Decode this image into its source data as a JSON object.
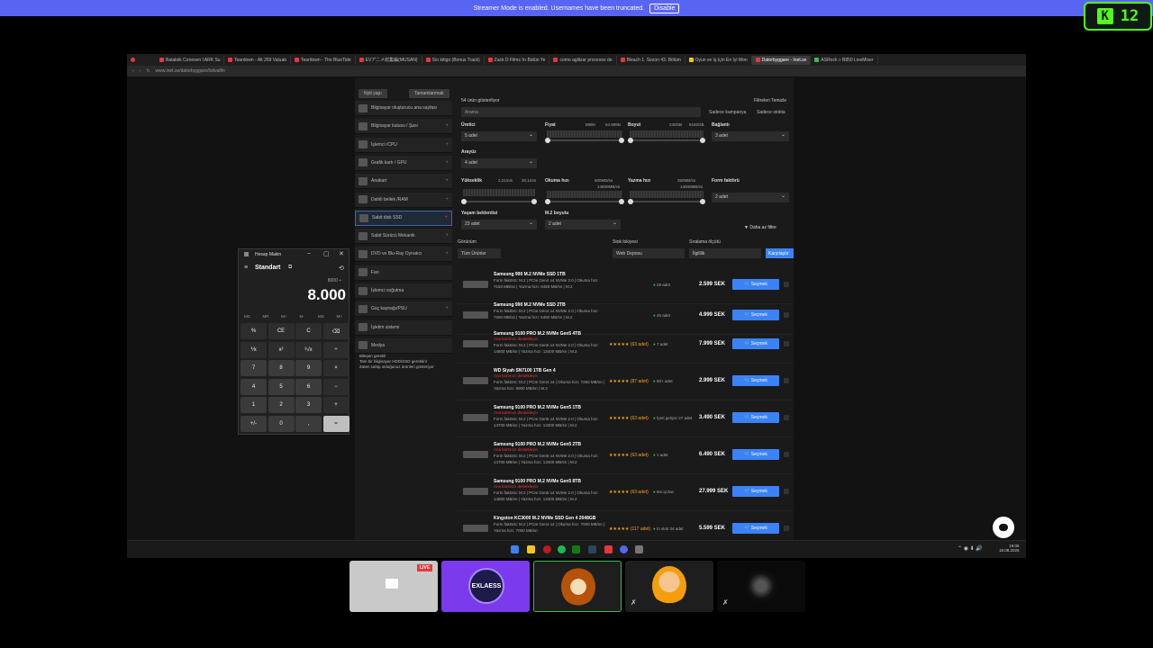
{
  "streamer": {
    "text": "Streamer Mode is enabled. Usernames have been truncated.",
    "disable": "Disable"
  },
  "kick": {
    "logo": "K",
    "count": "12"
  },
  "tabs": [
    "Batakkk Conexen l ARK Su",
    "Teardown - Alt 269 Valuab",
    "Teardown - The BlueTide",
    "EVアニメ総集編(MUSAN)",
    "S/o kitigo (Bonus Track)",
    "Zack D Films 'in Bütün Ye",
    "como agilizar procesos de",
    "Bleach 1. Sezon 43. Bölüm",
    "Oyun ve Iş Için En Iyi Mon",
    "Datorbyggare - Inet.se",
    "ASRock » B850 LiveMixer"
  ],
  "url": "www.inet.se/datorbyggare/lodvalfin",
  "site": {
    "btn_new": "Nytt yapı",
    "btn_complete": "Tamamlanmak",
    "categories": [
      "Bilgisayar oluşturucu ana sayfası",
      "Bilgisayar kutusu / Şasi",
      "İşlemci /CPU",
      "Grafik kartı / GPU",
      "Anakart",
      "Dahili bellek /RAM",
      "Sabit disk SSD",
      "Sabit Sürücü Mekanik",
      "DVD ve Blu-Ray Oynatıcı",
      "Fan",
      "İşlemci soğutma",
      "Güç kaynağı/PSU",
      "İşletim sistemi",
      "Medya"
    ],
    "notes": [
      "Bileşen gerekli",
      "Tam bir bilgisayar HDD/SSD gerektirir",
      "Zaten sahip olduğunuz ürünleri gösteriyor"
    ],
    "count": "54 ürün gösteriliyor",
    "reset": "Filtreleri Temizle",
    "search": "Arama",
    "compare": "Sadece kampanya",
    "instock": "Sadece stokta",
    "f": {
      "brand": "Üretici",
      "brand_v": "5 adet",
      "price": "Fiyat",
      "price_min": "899kr",
      "price_max": "54.999kr",
      "size": "Boyut",
      "size_min": "240GB",
      "size_max": "8192GB",
      "conn": "Bağlantı",
      "conn_v": "3 adet",
      "iface": "Arayüz",
      "iface_v": "4 adet",
      "height": "Yükseklik",
      "h_min": "2,21mm",
      "h_max": "30,1mm",
      "read": "Okuma hızı",
      "read_min": "500MB/sn",
      "read_max": "14800MB/sn",
      "write": "Yazma hızı",
      "write_min": "350MB/sn",
      "write_max": "14000MB/sn",
      "form": "Form faktörü",
      "form_v": "2 adet",
      "life": "Yaşam beklentisi",
      "life_v": "23 adet",
      "m2": "M.2 boyutu",
      "m2_v": "2 adet",
      "more": "Daha az filtre"
    },
    "view": "Görünüm",
    "view_v": "Tüm Ürünler",
    "stockloc": "Stok lokiyesi",
    "stockloc_v": "Web Deposu",
    "sort": "Sıralama ölçütü",
    "sort_v": "İlgililik",
    "compare_btn": "Karşılaştır",
    "products": [
      {
        "name": "Samsung 990 M.2 NVMe SSD 1TB",
        "warn": "",
        "desc": "Form faktörü: M.2 | PCIe Gen4 x4 NVMe 2.0 | Okuma hızı: 7150 MB/sn | Yazma hızı: 6450 MB/sn | M.2",
        "stars": "",
        "stock": "29 adet",
        "price": "2.599 SEK",
        "buy": "Seçmek"
      },
      {
        "name": "Samsung 990 M.2 NVMe SSD 2TB",
        "warn": "",
        "desc": "Form faktörü: M.2 | PCIe Gen4 x4 NVMe 2.0 | Okuma hızı: 7250 MB/sn | Yazma hızı: 6450 MB/sn | M.2",
        "stars": "",
        "stock": "46 adet",
        "price": "4.999 SEK",
        "buy": "Seçmek"
      },
      {
        "name": "Samsung 9100 PRO M.2 NVMe Gen5 4TB",
        "warn": "Ana kartınızı destekleyin",
        "desc": "Form faktörü: M.2 | PCIe Gen5 x4 NVMe 2.0 | Okuma hızı: 14800 MB/sn | Yazma hızı: 13400 MB/sn | M.2",
        "stars": "★★★★★ (63 adet)",
        "stock": "7 adet",
        "price": "7.999 SEK",
        "buy": "Seçmek"
      },
      {
        "name": "WD Siyah SN7100 1TB Gen 4",
        "warn": "Ana kartınızı destekleyin",
        "desc": "Form faktörü: M.2 | PCIe Gen4 x4 | Okuma hızı: 7250 MB/sn | Yazma hızı: 6900 MB/sn | M.2",
        "stars": "★★★★★ (87 adet)",
        "stock": "50+ adet",
        "price": "2.999 SEK",
        "buy": "Seçmek"
      },
      {
        "name": "Samsung 9100 PRO M.2 NVMe Gen5 1TB",
        "warn": "Ana kartınızı destekleyin",
        "desc": "Form faktörü: M.2 | PCIe Gen5 x4 NVMe 2.0 | Okuma hızı: 14700 MB/sn | Yazma hızı: 13300 MB/sn | M.2",
        "stars": "★★★★★ (63 adet)",
        "stock": "İçeri geliyor 27 adet",
        "price": "3.490 SEK",
        "buy": "Seçmek"
      },
      {
        "name": "Samsung 9100 PRO M.2 NVMe Gen5 2TB",
        "warn": "Ana kartınızı destekleyin",
        "desc": "Form faktörü: M.2 | PCIe Gen5 x4 NVMe 2.0 | Okuma hızı: 14700 MB/sn | Yazma hızı: 13400 MB/sn | M.2",
        "stars": "★★★★★ (63 adet)",
        "stock": "1 adet",
        "price": "6.490 SEK",
        "buy": "Seçmek"
      },
      {
        "name": "Samsung 9100 PRO M.2 NVMe Gen5 8TB",
        "warn": "Ana kartınızı destekleyin",
        "desc": "Form faktörü: M.2 | PCIe Gen5 x4 NVMe 2.0 | Okuma hızı: 14800 MB/sn | Yazma hızı: 13400 MB/sn | M.2",
        "stars": "★★★★★ (63 adet)",
        "stock": "6m.iyi.bw",
        "price": "27.999 SEK",
        "buy": "Seçmek"
      },
      {
        "name": "Kingston KC3000 M.2 NVMe SSD Gen 4 2048GB",
        "warn": "",
        "desc": "Form faktörü: M.2 | PCIe Gen4 x4 | Okuma hızı: 7000 MB/sn | Yazma hızı: 7000 MB/sn",
        "stars": "★★★★★ (117 adet)",
        "stock": "İn stok 34 adet",
        "price": "5.599 SEK",
        "buy": "Seçmek"
      }
    ]
  },
  "calc": {
    "title": "Hesap Makin",
    "mode": "Standart",
    "expr": "8000 ÷",
    "display": "8.000",
    "mem": [
      "MC",
      "MR",
      "M+",
      "M-",
      "MS",
      "M˅"
    ],
    "keys": [
      "%",
      "CE",
      "C",
      "⌫",
      "⅟x",
      "x²",
      "²√x",
      "÷",
      "7",
      "8",
      "9",
      "×",
      "4",
      "5",
      "6",
      "−",
      "1",
      "2",
      "3",
      "+",
      "+/-",
      "0",
      ",",
      "="
    ]
  },
  "clock": {
    "time": "19:06",
    "date": "18.08.2026"
  },
  "cams": {
    "live": "LIVE",
    "logo": "EXLAESS"
  }
}
